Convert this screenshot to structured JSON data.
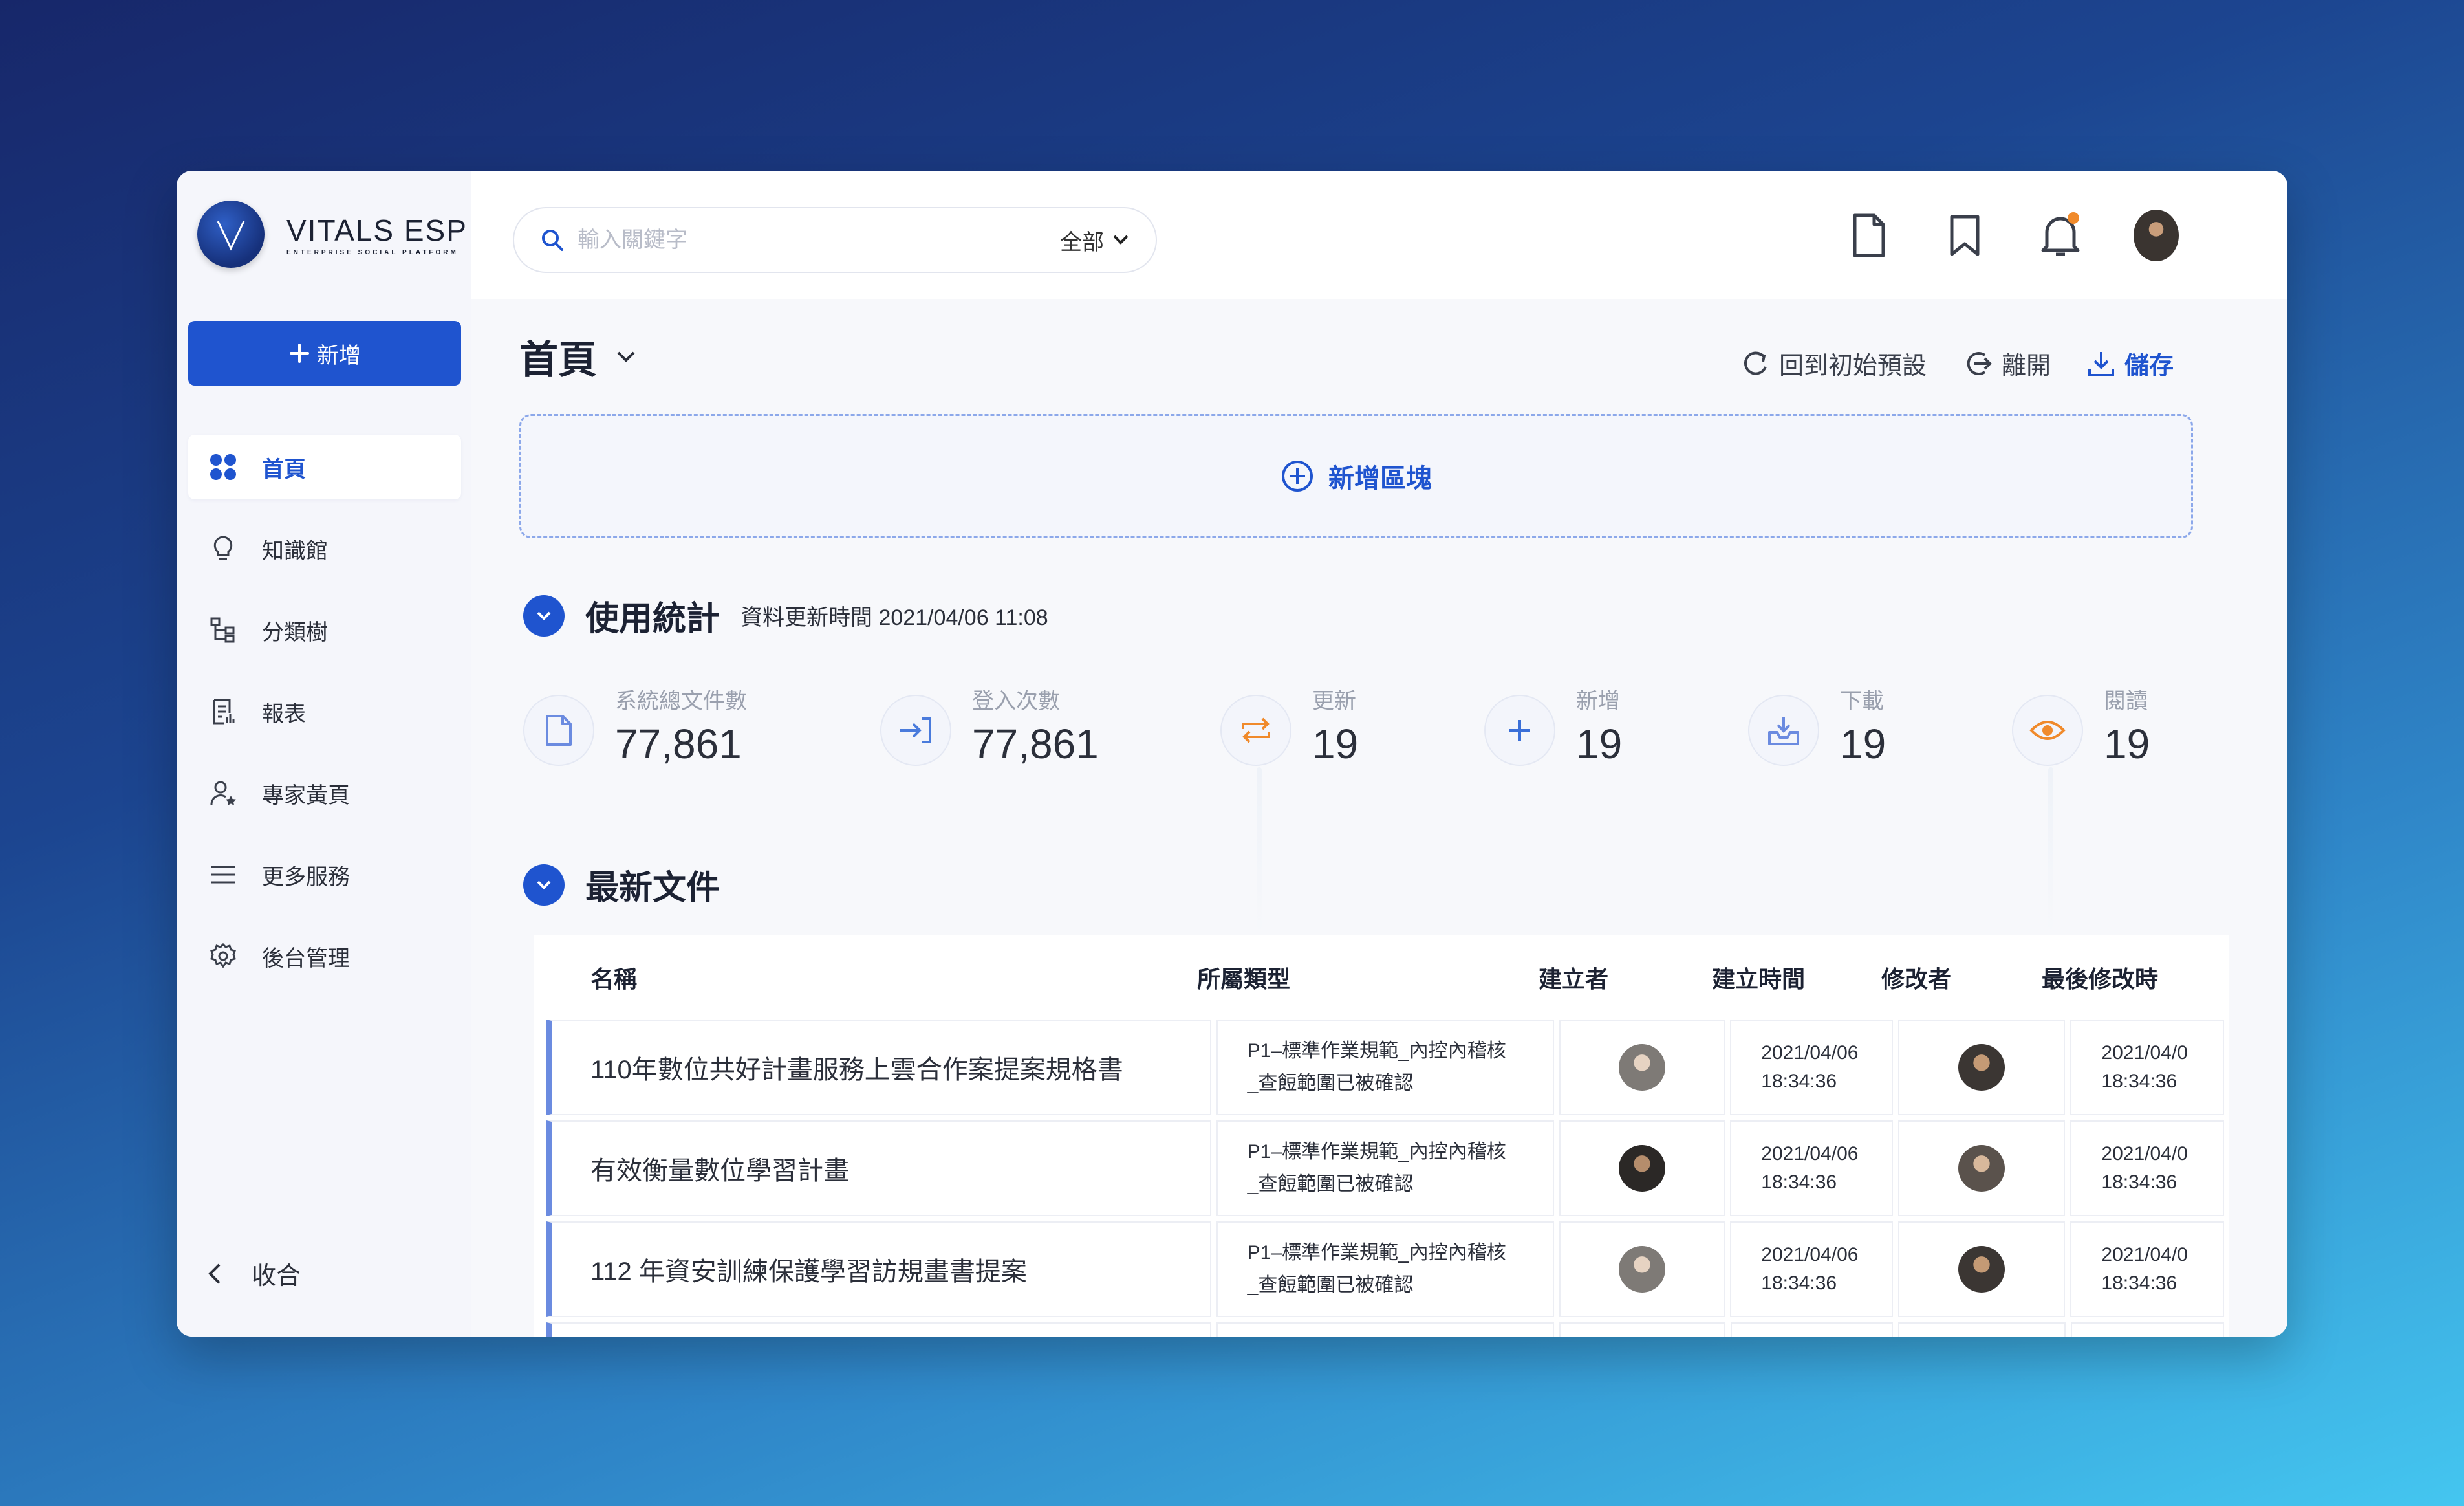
{
  "brand": {
    "name": "VITALS ESP",
    "sub": "ENTERPRISE SOCIAL PLATFORM",
    "logo_letter": "V"
  },
  "sidebar": {
    "new_label": "新增",
    "items": [
      {
        "label": "首頁",
        "icon": "grid-icon",
        "active": true
      },
      {
        "label": "知識館",
        "icon": "bulb-icon"
      },
      {
        "label": "分類樹",
        "icon": "tree-icon"
      },
      {
        "label": "報表",
        "icon": "report-icon"
      },
      {
        "label": "專家黃頁",
        "icon": "expert-icon"
      },
      {
        "label": "更多服務",
        "icon": "menu-icon"
      },
      {
        "label": "後台管理",
        "icon": "gear-icon"
      }
    ],
    "collapse_label": "收合"
  },
  "search": {
    "placeholder": "輸入關鍵字",
    "scope": "全部"
  },
  "page": {
    "title": "首頁",
    "actions": {
      "reset": "回到初始預設",
      "leave": "離開",
      "save": "儲存"
    },
    "add_block": "新增區塊"
  },
  "stats_section": {
    "title": "使用統計",
    "updated": "資料更新時間 2021/04/06 11:08",
    "items": [
      {
        "label": "系統總文件數",
        "value": "77,861",
        "color": "#6b8be0"
      },
      {
        "label": "登入次數",
        "value": "77,861",
        "color": "#4a7bdc"
      },
      {
        "label": "更新",
        "value": "19",
        "color": "#f08a2b"
      },
      {
        "label": "新增",
        "value": "19",
        "color": "#3a6fd8"
      },
      {
        "label": "下載",
        "value": "19",
        "color": "#6b8be0"
      },
      {
        "label": "閱讀",
        "value": "19",
        "color": "#f08a2b"
      }
    ]
  },
  "docs_section": {
    "title": "最新文件",
    "columns": [
      "名稱",
      "所屬類型",
      "建立者",
      "建立時間",
      "修改者",
      "最後修改時"
    ],
    "rows": [
      {
        "name": "110年數位共好計畫服務上雲合作案提案規格書",
        "type1": "P1–標準作業規範_內控內稽核",
        "type2": "_查餖範圍已被確認",
        "created_date": "2021/04/06",
        "created_time": "18:34:36",
        "modified_date": "2021/04/0",
        "modified_time": "18:34:36"
      },
      {
        "name": "有效衡量數位學習計畫",
        "type1": "P1–標準作業規範_內控內稽核",
        "type2": "_查餖範圍已被確認",
        "created_date": "2021/04/06",
        "created_time": "18:34:36",
        "modified_date": "2021/04/0",
        "modified_time": "18:34:36"
      },
      {
        "name": "112 年資安訓練保護學習訪規畫書提案",
        "type1": "P1–標準作業規範_內控內稽核",
        "type2": "_查餖範圍已被確認",
        "created_date": "2021/04/06",
        "created_time": "18:34:36",
        "modified_date": "2021/04/0",
        "modified_time": "18:34:36"
      }
    ]
  }
}
